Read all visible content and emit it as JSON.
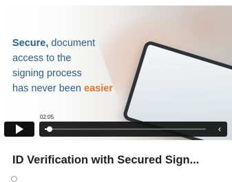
{
  "video": {
    "headline": {
      "line1_strong": "Secure,",
      "line1_rest": " document",
      "line2": "access to the",
      "line3": "signing process",
      "line4_prefix": "has never been ",
      "line4_accent": "easier"
    },
    "timestamp": "02:05",
    "progress_fraction": 0.03
  },
  "card": {
    "title": "ID Verification with Secured Sign..."
  },
  "colors": {
    "headline_blue": "#2a5d8c",
    "accent_orange": "#e2782e",
    "control_bg": "#111111"
  },
  "icons": [
    "play-icon",
    "chevron-left-icon"
  ]
}
